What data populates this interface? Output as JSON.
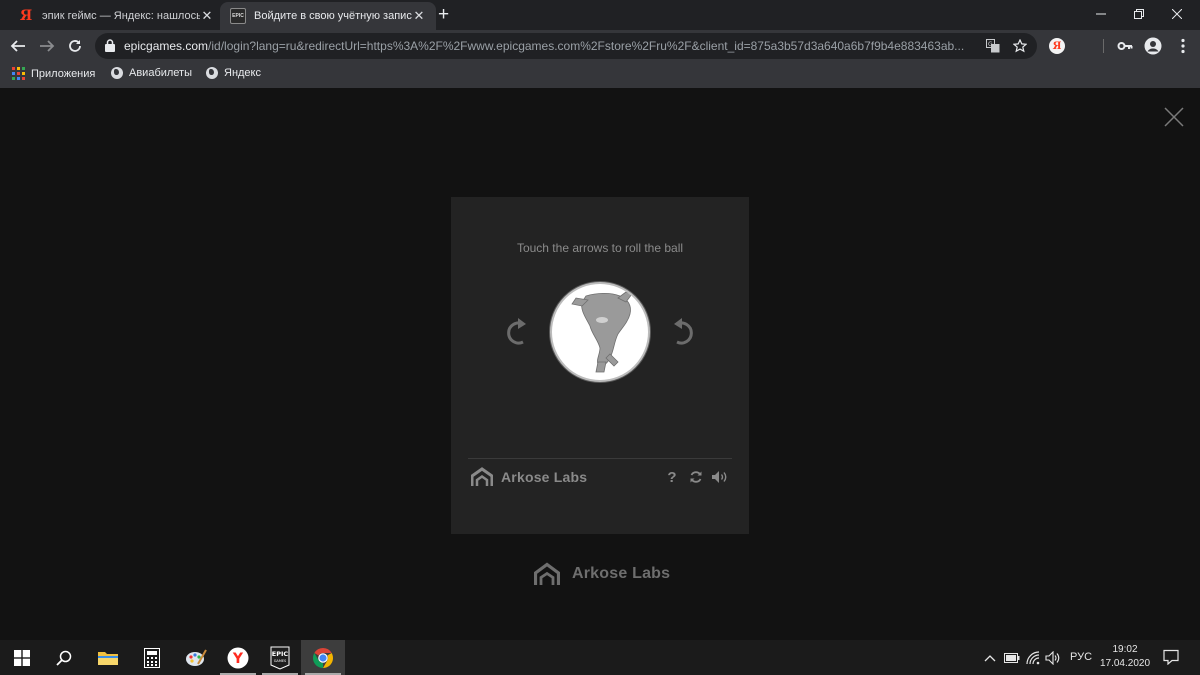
{
  "browser": {
    "tabs": [
      {
        "title": "эпик геймс — Яндекс: нашлось",
        "favicon": "yandex-favicon",
        "active": false
      },
      {
        "title": "Войдите в свою учётную запись",
        "favicon": "epic-games-favicon",
        "active": true
      }
    ],
    "favicon_epic_text": "EPIC",
    "new_tab_glyph": "+",
    "close_glyph": "✕",
    "address": {
      "host": "epicgames.com",
      "path": "/id/login?lang=ru&redirectUrl=https%3A%2F%2Fwww.epicgames.com%2Fstore%2Fru%2F&client_id=875a3b57d3a640a6b7f9b4e883463ab..."
    },
    "extension_label": "Я",
    "bookmarks": [
      {
        "label": "Приложения",
        "icon": "apps-grid-icon"
      },
      {
        "label": "Авиабилеты",
        "icon": "globe-icon"
      },
      {
        "label": "Яндекс",
        "icon": "globe-icon"
      }
    ]
  },
  "captcha": {
    "instruction": "Touch the arrows to roll the ball",
    "brand": "Arkose Labs",
    "help_glyph": "?",
    "image": "rotated-animal-figure"
  },
  "page": {
    "brand": "Arkose Labs"
  },
  "taskbar": {
    "apps": [
      "start",
      "search",
      "file-explorer",
      "calculator",
      "paint",
      "yandex-browser",
      "epic-games-launcher",
      "chrome"
    ],
    "epic_label_top": "EPIC",
    "epic_label_bottom": "GAMES",
    "yandex_label": "Y",
    "language": "РУС",
    "time": "19:02",
    "date": "17.04.2020"
  },
  "colors": {
    "page_background": "#121212",
    "captcha_background": "#232323",
    "chrome_dark": "#202124",
    "chrome_toolbar": "#35363a",
    "yandex_red": "#ff3b1f"
  }
}
